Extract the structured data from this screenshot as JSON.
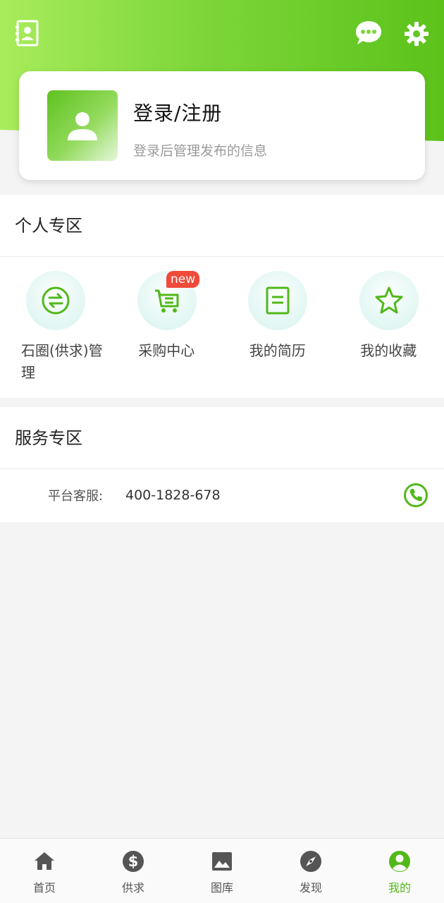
{
  "header": {
    "left_icon": "contact-card-icon",
    "right_icons": [
      "chat-icon",
      "gear-icon"
    ]
  },
  "profile": {
    "title": "登录/注册",
    "subtitle": "登录后管理发布的信息",
    "avatar_icon": "user-icon"
  },
  "personal": {
    "title": "个人专区",
    "items": [
      {
        "label": "石圈(供求)管理",
        "icon": "exchange-icon"
      },
      {
        "label": "采购中心",
        "icon": "cart-icon",
        "badge": "new"
      },
      {
        "label": "我的简历",
        "icon": "document-icon"
      },
      {
        "label": "我的收藏",
        "icon": "star-icon"
      }
    ]
  },
  "service": {
    "title": "服务专区",
    "row_label": "平台客服:",
    "row_value": "400-1828-678",
    "row_icon": "phone-icon"
  },
  "nav": {
    "items": [
      {
        "label": "首页",
        "icon": "home-icon",
        "active": false
      },
      {
        "label": "供求",
        "icon": "dollar-icon",
        "active": false
      },
      {
        "label": "图库",
        "icon": "image-icon",
        "active": false
      },
      {
        "label": "发现",
        "icon": "compass-icon",
        "active": false
      },
      {
        "label": "我的",
        "icon": "user-circle-icon",
        "active": true
      }
    ]
  },
  "colors": {
    "accent": "#52b81a",
    "header_gradient_start": "#a8ec5c",
    "header_gradient_end": "#5cc21a",
    "badge": "#f04a3a"
  }
}
